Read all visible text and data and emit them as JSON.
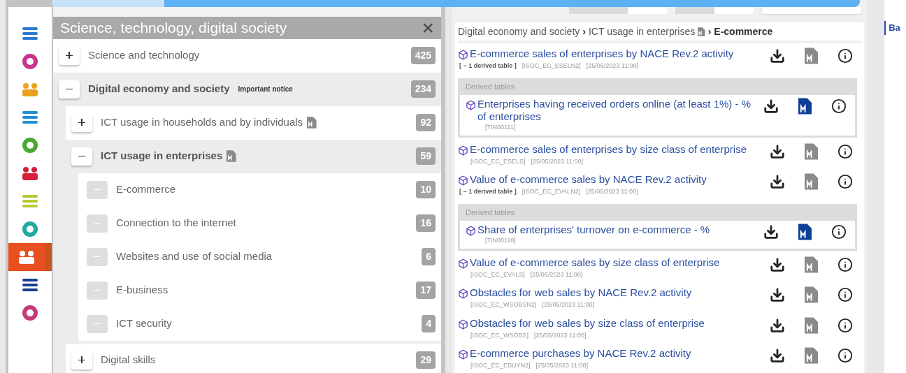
{
  "categories": [
    {
      "selected": false
    },
    {
      "selected": false
    },
    {
      "selected": false
    },
    {
      "selected": false
    },
    {
      "selected": false
    },
    {
      "selected": false
    },
    {
      "selected": false
    },
    {
      "selected": false
    },
    {
      "selected": true
    },
    {
      "selected": false
    },
    {
      "selected": false
    }
  ],
  "tree": {
    "title": "Science, technology, digital society",
    "close": "×",
    "items": [
      {
        "label": "Science and technology",
        "count": "425",
        "kind": "folder",
        "expanded": false,
        "bold": false
      },
      {
        "label": "Digital economy and society",
        "notice": "Important notice",
        "count": "234",
        "kind": "folder",
        "expanded": true,
        "bold": true,
        "children": [
          {
            "label": "ICT usage in households and by individuals",
            "count": "92",
            "kind": "folder",
            "expanded": false,
            "bold": false,
            "metadata": true
          },
          {
            "label": "ICT usage in enterprises",
            "count": "59",
            "kind": "folder",
            "expanded": true,
            "bold": true,
            "metadata": true,
            "children": [
              {
                "label": "E-commerce",
                "count": "10",
                "kind": "leaf"
              },
              {
                "label": "Connection to the internet",
                "count": "16",
                "kind": "leaf"
              },
              {
                "label": "Websites and use of social media",
                "count": "6",
                "kind": "leaf"
              },
              {
                "label": "E-business",
                "count": "17",
                "kind": "leaf"
              },
              {
                "label": "ICT security",
                "count": "4",
                "kind": "leaf"
              }
            ]
          },
          {
            "label": "Digital skills",
            "count": "29",
            "kind": "folder",
            "expanded": false,
            "bold": false
          }
        ]
      }
    ]
  },
  "breadcrumb": [
    {
      "label": "Digital economy and society",
      "current": false
    },
    {
      "separator": "›",
      "label": "ICT usage in enterprises",
      "current": false,
      "metadata": true
    },
    {
      "separator": "›",
      "label": "E-commerce",
      "current": true
    }
  ],
  "datasets": [
    {
      "title": "E-commerce sales of enterprises by NACE Rev.2 activity",
      "derived_toggle": "[ − 1 derived table ]",
      "code": "[ISOC_EC_ESELN2]",
      "date": "[25/05/2023 11:00]",
      "metadata_highlighted": false,
      "derived_heading": "Derived tables",
      "derived": [
        {
          "title": "Enterprises having received orders online (at least 1%) - % of enterprises",
          "code": "[TIN00111]",
          "metadata_highlighted": true
        }
      ]
    },
    {
      "title": "E-commerce sales of enterprises by size class of enterprise",
      "code": "[ISOC_EC_ESELS]",
      "date": "[25/05/2023 11:00]",
      "metadata_highlighted": false
    },
    {
      "title": "Value of e-commerce sales by NACE Rev.2 activity",
      "derived_toggle": "[ − 1 derived table ]",
      "code": "[ISOC_EC_EVALN2]",
      "date": "[25/05/2023 11:00]",
      "metadata_highlighted": false,
      "derived_heading": "Derived tables",
      "derived": [
        {
          "title": "Share of enterprises' turnover on e-commerce - %",
          "code": "[TIN00110]",
          "metadata_highlighted": true
        }
      ]
    },
    {
      "title": "Value of e-commerce sales by size class of enterprise",
      "code": "[ISOC_EC_EVALS]",
      "date": "[25/05/2023 11:00]",
      "metadata_highlighted": false
    },
    {
      "title": "Obstacles for web sales by NACE Rev.2 activity",
      "code": "[ISOC_EC_WSOBSN2]",
      "date": "[25/05/2023 11:00]",
      "metadata_highlighted": false
    },
    {
      "title": "Obstacles for web sales by size class of enterprise",
      "code": "[ISOC_EC_WSOBS]",
      "date": "[25/05/2023 11:00]",
      "metadata_highlighted": false
    },
    {
      "title": "E-commerce purchases by NACE Rev.2 activity",
      "code": "[ISOC_EC_EBUYN2]",
      "date": "[25/05/2023 11:00]",
      "metadata_highlighted": false
    }
  ],
  "side_tab": {
    "label": "Ba"
  }
}
